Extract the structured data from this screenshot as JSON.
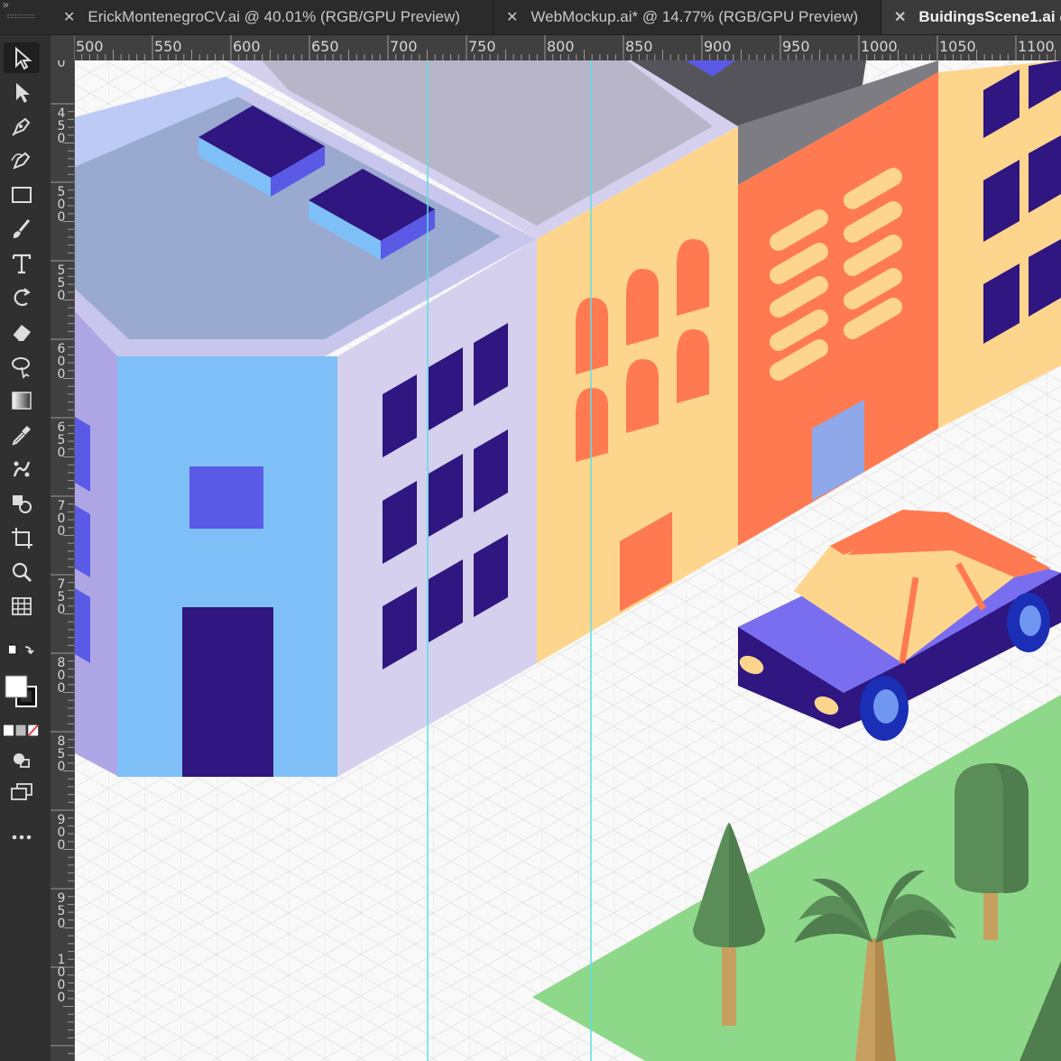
{
  "tabs": [
    {
      "label": "ErickMontenegroCV.ai @ 40.01% (RGB/GPU Preview)",
      "active": false
    },
    {
      "label": "WebMockup.ai* @ 14.77% (RGB/GPU Preview)",
      "active": false
    },
    {
      "label": "BuidingsScene1.ai @",
      "active": true
    }
  ],
  "rulers": {
    "horizontal": [
      "500",
      "550",
      "600",
      "650",
      "700",
      "750",
      "800",
      "850",
      "900",
      "950",
      "1000",
      "1050",
      "1100"
    ],
    "vertical": [
      "450",
      "500",
      "550",
      "600",
      "650",
      "700",
      "750",
      "800",
      "850",
      "900",
      "950",
      "1000"
    ],
    "vertical_top_partial": "0"
  },
  "tools": [
    {
      "name": "selection-tool-icon"
    },
    {
      "name": "direct-selection-tool-icon"
    },
    {
      "name": "pen-tool-icon"
    },
    {
      "name": "curvature-tool-icon"
    },
    {
      "name": "rectangle-tool-icon"
    },
    {
      "name": "paintbrush-tool-icon"
    },
    {
      "name": "type-tool-icon"
    },
    {
      "name": "rotate-tool-icon"
    },
    {
      "name": "eraser-tool-icon"
    },
    {
      "name": "lasso-selection-tool-icon"
    },
    {
      "name": "gradient-tool-icon"
    },
    {
      "name": "eyedropper-tool-icon"
    },
    {
      "name": "puppet-warp-tool-icon"
    },
    {
      "name": "shape-builder-tool-icon"
    },
    {
      "name": "artboard-tool-icon"
    },
    {
      "name": "zoom-tool-icon"
    },
    {
      "name": "chart-tool-icon"
    },
    {
      "name": "swap-fill-stroke-icon"
    },
    {
      "name": "fill-stroke-swatch-icon"
    },
    {
      "name": "color-modes-icon"
    },
    {
      "name": "draw-modes-icon"
    },
    {
      "name": "screen-mode-icon"
    },
    {
      "name": "more-tools-icon"
    }
  ],
  "colors": {
    "guide": "#5ce0e6",
    "building_roof": "#9aa9cf",
    "building_front": "#7fbff7",
    "building_side": "#d4d0ee",
    "window_dark": "#2f1680",
    "skylight_blue": "#5a5ae6",
    "yellow_building": "#fed58c",
    "orange_building": "#ff7a50",
    "grass": "#8ed88a",
    "tree_dark": "#4f7d4d",
    "trunk": "#c7a060"
  }
}
